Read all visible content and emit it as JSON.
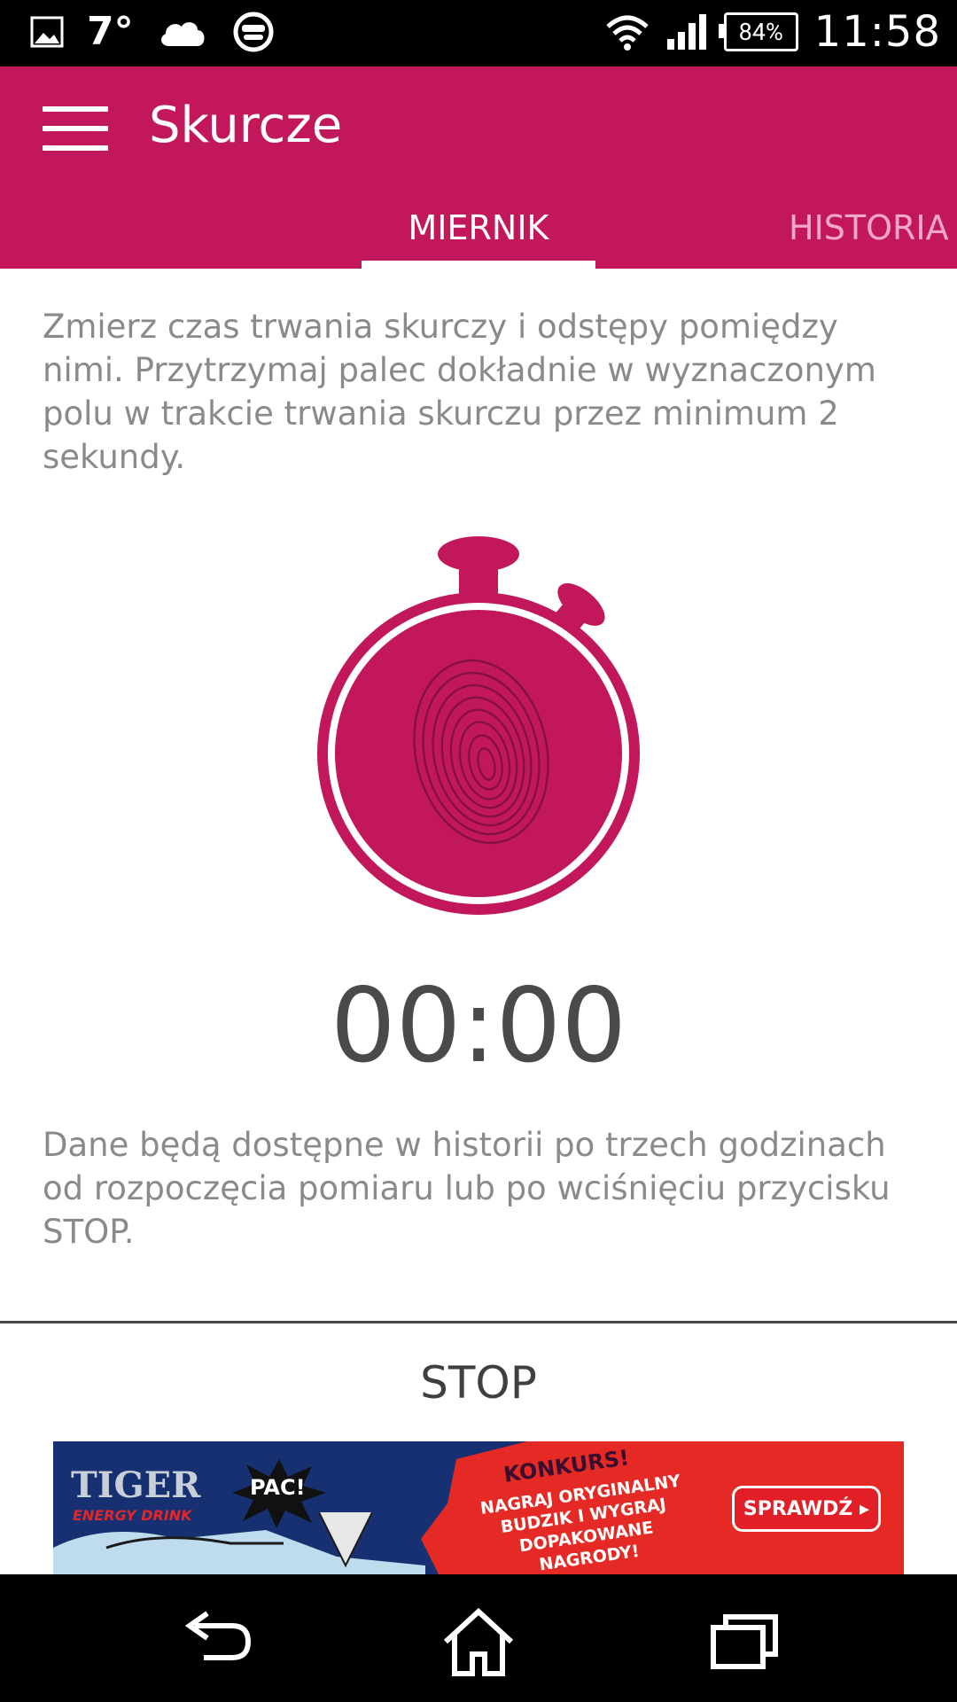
{
  "status_bar": {
    "temperature": "7°",
    "battery": "84%",
    "time": "11:58",
    "icons": [
      "gallery-icon",
      "cloud-icon",
      "voicemail-icon",
      "wifi-icon",
      "signal-icon",
      "battery-icon"
    ]
  },
  "app_bar": {
    "title": "Skurcze",
    "menu_icon": "hamburger-menu-icon",
    "background": "#c2185b"
  },
  "tabs": [
    {
      "label": "MIERNIK",
      "active": true
    },
    {
      "label": "HISTORIA",
      "active": false
    }
  ],
  "main": {
    "instructions": "Zmierz czas trwania skurczy i odstępy pomiędzy nimi. Przytrzymaj palec dokładnie w wyznaczonym polu w trakcie trwania skurczu przez minimum 2 sekundy.",
    "stopwatch_icon": "stopwatch-fingerprint-icon",
    "timer": "00:00",
    "info": "Dane będą dostępne w historii po trzech godzinach od rozpoczęcia pomiaru lub po wciśnięciu przycisku STOP.",
    "stop_label": "STOP"
  },
  "ad": {
    "brand": "TIGER",
    "brand_sub": "ENERGY DRINK",
    "pac": "PAC!",
    "headline": "KONKURS!",
    "body": "NAGRAJ ORYGINALNY BUDZIK I WYGRAJ DOPAKOWANE NAGRODY!",
    "cta": "SPRAWDŹ ▸"
  },
  "nav_bar": {
    "icons": [
      "back-icon",
      "home-icon",
      "recents-icon"
    ]
  }
}
